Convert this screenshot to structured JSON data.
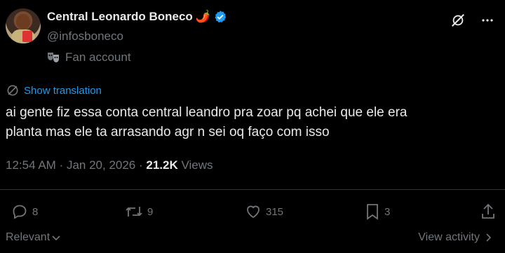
{
  "author": {
    "name": "Central Leonardo Boneco",
    "name_emoji": "🌶️",
    "handle": "@infosboneco",
    "account_label": "Fan account",
    "verified_color": "#1d9bf0"
  },
  "post": {
    "show_translation": "Show translation",
    "text_line1": "ai gente fiz essa conta central leandro pra zoar pq achei que ele era",
    "text_line2": "planta mas ele ta arrasando agr n sei oq faço com isso",
    "time": "12:54 AM",
    "date": "Jan 20, 2026",
    "views_count": "21.2K",
    "views_label": "Views"
  },
  "actions": {
    "replies": "8",
    "reposts": "9",
    "likes": "315",
    "bookmarks": "3"
  },
  "footer": {
    "sort_label": "Relevant",
    "view_activity": "View activity"
  },
  "colors": {
    "background": "#000000",
    "text": "#e7e9ea",
    "muted": "#71767b",
    "accent": "#1d9bf0"
  }
}
